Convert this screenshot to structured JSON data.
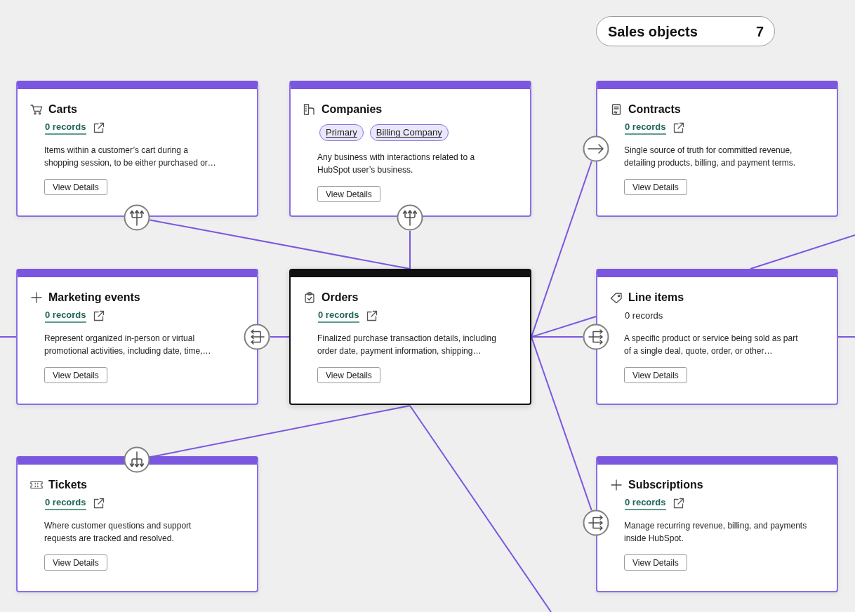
{
  "group": {
    "title": "Sales objects",
    "count": "7"
  },
  "cards": [
    {
      "title": "Carts",
      "selected": false,
      "records": {
        "text": "0 records",
        "linked": true
      },
      "description": "Items within a customer’s cart during a shopping session, to be either purchased or…",
      "button": "View Details"
    },
    {
      "title": "Companies",
      "selected": false,
      "tags": [
        "Primary",
        "Billing Company"
      ],
      "description": "Any business with interactions related to a HubSpot user’s business.",
      "button": "View Details"
    },
    {
      "title": "Contracts",
      "selected": false,
      "records": {
        "text": "0 records",
        "linked": true
      },
      "description": "Single source of truth for committed revenue, detailing products, billing, and payment terms.",
      "button": "View Details"
    },
    {
      "title": "Marketing events",
      "selected": false,
      "records": {
        "text": "0 records",
        "linked": true
      },
      "description": "Represent organized in-person or virtual promotional activities, including date, time,…",
      "button": "View Details"
    },
    {
      "title": "Orders",
      "selected": true,
      "records": {
        "text": "0 records",
        "linked": true
      },
      "description": "Finalized purchase transaction details, including order date, payment information, shipping…",
      "button": "View Details"
    },
    {
      "title": "Line items",
      "selected": false,
      "records": {
        "text": "0 records",
        "linked": false
      },
      "description": "A specific product or service being sold as part of a single deal, quote, order, or other…",
      "button": "View Details"
    },
    {
      "title": "Tickets",
      "selected": false,
      "records": {
        "text": "0 records",
        "linked": true
      },
      "description": "Where customer questions and support requests are tracked and resolved.",
      "button": "View Details"
    },
    {
      "title": "Subscriptions",
      "selected": false,
      "records": {
        "text": "0 records",
        "linked": true
      },
      "description": "Manage recurring revenue, billing, and payments inside HubSpot.",
      "button": "View Details"
    }
  ]
}
